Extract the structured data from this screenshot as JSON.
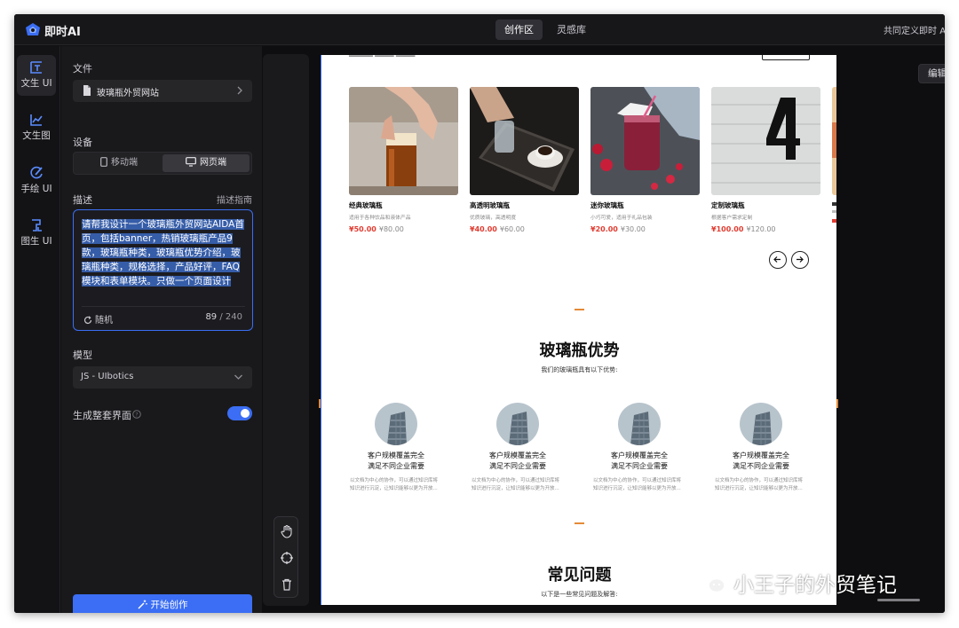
{
  "app": {
    "brand": "即时AI",
    "accent": "#3b6ef4"
  },
  "top_nav": {
    "tabs": [
      "创作区",
      "灵感库"
    ],
    "active": "创作区",
    "right_text": "共同定义即时 AI"
  },
  "rail": [
    {
      "label": "文生 UI",
      "icon": "text-to-ui-icon",
      "active": true
    },
    {
      "label": "文生图",
      "icon": "text-to-image-icon",
      "active": false
    },
    {
      "label": "手绘 UI",
      "icon": "sketch-ui-icon",
      "active": false
    },
    {
      "label": "图生 UI",
      "icon": "image-to-ui-icon",
      "active": false
    }
  ],
  "panel": {
    "file_label": "文件",
    "file_name": "玻璃瓶外贸网站",
    "device_label": "设备",
    "device_options": [
      "移动端",
      "网页端"
    ],
    "device_selected": "网页端",
    "desc_label": "描述",
    "desc_guide": "描述指南",
    "desc_text": "请帮我设计一个玻璃瓶外贸网站AIDA首页，包括banner，热销玻璃瓶产品9款，玻璃瓶种类，玻璃瓶优势介绍，玻璃瓶种类，规格选择，产品好评，FAQ模块和表单模块。只做一个页面设计",
    "random_label": "随机",
    "char_count": "89",
    "char_max": "/ 240",
    "model_label": "模型",
    "model_value": "JS - UIbotics",
    "gen_full_label": "生成整套界面",
    "gen_full_enabled": true,
    "start_button": "开始创作"
  },
  "canvas": {
    "edit_button": "编辑"
  },
  "preview": {
    "products": [
      {
        "name": "经典玻璃瓶",
        "desc": "适用于各种饮品和液体产品",
        "price": "¥50.00",
        "old_price": "¥80.00"
      },
      {
        "name": "高透明玻璃瓶",
        "desc": "优质玻璃，高透明度",
        "price": "¥40.00",
        "old_price": "¥60.00"
      },
      {
        "name": "迷你玻璃瓶",
        "desc": "小巧可爱，适用于礼品包装",
        "price": "¥20.00",
        "old_price": "¥30.00"
      },
      {
        "name": "定制玻璃瓶",
        "desc": "根据客户需求定制",
        "price": "¥100.00",
        "old_price": "¥120.00"
      }
    ],
    "advantages": {
      "title": "玻璃瓶优势",
      "subtitle": "我们的玻璃瓶具有以下优势:",
      "items": [
        {
          "title_1": "客户规模覆盖完全",
          "title_2": "满足不同企业需要",
          "desc": "以文档为中心的协作，可以通过知识库将知识进行沉淀，让知识能够以更为开放..."
        },
        {
          "title_1": "客户规模覆盖完全",
          "title_2": "满足不同企业需要",
          "desc": "以文档为中心的协作，可以通过知识库将知识进行沉淀，让知识能够以更为开放..."
        },
        {
          "title_1": "客户规模覆盖完全",
          "title_2": "满足不同企业需要",
          "desc": "以文档为中心的协作，可以通过知识库将知识进行沉淀，让知识能够以更为开放..."
        },
        {
          "title_1": "客户规模覆盖完全",
          "title_2": "满足不同企业需要",
          "desc": "以文档为中心的协作，可以通过知识库将知识进行沉淀，让知识能够以更为开放..."
        }
      ]
    },
    "faq": {
      "title": "常见问题",
      "subtitle": "以下是一些常见问题及解答:"
    }
  },
  "watermark": "小王子的外贸笔记"
}
